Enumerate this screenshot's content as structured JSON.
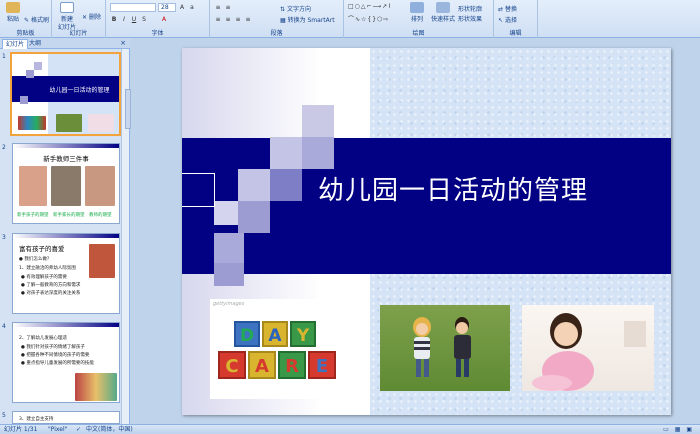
{
  "ribbon": {
    "clipboard": {
      "paste": "粘贴",
      "format_painter": "格式刷",
      "label": "剪贴板"
    },
    "slides": {
      "new_slide": "新建",
      "new_slide2": "幻灯片",
      "delete": "删除",
      "label": "幻灯片"
    },
    "font": {
      "size": "28",
      "label": "字体"
    },
    "paragraph": {
      "text_direction": "文字方向",
      "convert": "转换为 SmartArt",
      "label": "段落"
    },
    "drawing": {
      "arrange": "排列",
      "quick_styles": "快速样式",
      "shape_fill": "形状轮廓",
      "shape_effects": "形状效果",
      "label": "绘图"
    },
    "editing": {
      "replace": "替换",
      "select": "选择",
      "label": "编辑"
    }
  },
  "panel": {
    "tabs": [
      "幻灯片",
      "大纲"
    ],
    "close": "×",
    "slides": [
      {
        "num": "1",
        "title": "幼儿园一日活动的管理"
      },
      {
        "num": "2",
        "title": "新手教师三件事",
        "captions": [
          "新手孩子的期望",
          "新手家长的期望",
          "教师的期望"
        ]
      },
      {
        "num": "3",
        "title": "富有孩子的喜爱",
        "lines": [
          "● 我们怎么做？",
          "1、建立融洽的师幼人际氛围",
          "● 有效理解孩子的需要",
          "● 了解一般教育的方向和需求",
          "● 对孩子表达深度的关注关系"
        ]
      },
      {
        "num": "4",
        "lines": [
          "2、了解幼儿发展心理适",
          "● 我们针对孩子的情绪了解孩子",
          "● 把握各种不同情境的孩子的需要",
          "● 重点指导儿童发展的所需要的技能"
        ]
      },
      {
        "num": "5",
        "lines": [
          "3、建立自主支持"
        ]
      }
    ]
  },
  "slide": {
    "title": "幼儿园一日活动的管理",
    "daycare_row1": [
      "D",
      "A",
      "Y"
    ],
    "daycare_row2": [
      "C",
      "A",
      "R",
      "E"
    ],
    "watermark": "gettyimages"
  },
  "status": {
    "slide": "幻灯片 1/31",
    "theme": "\"Pixel\"",
    "lang": "中文(简体，中国)"
  },
  "colors": {
    "band": "#020083",
    "accent": "#f3a33b"
  }
}
